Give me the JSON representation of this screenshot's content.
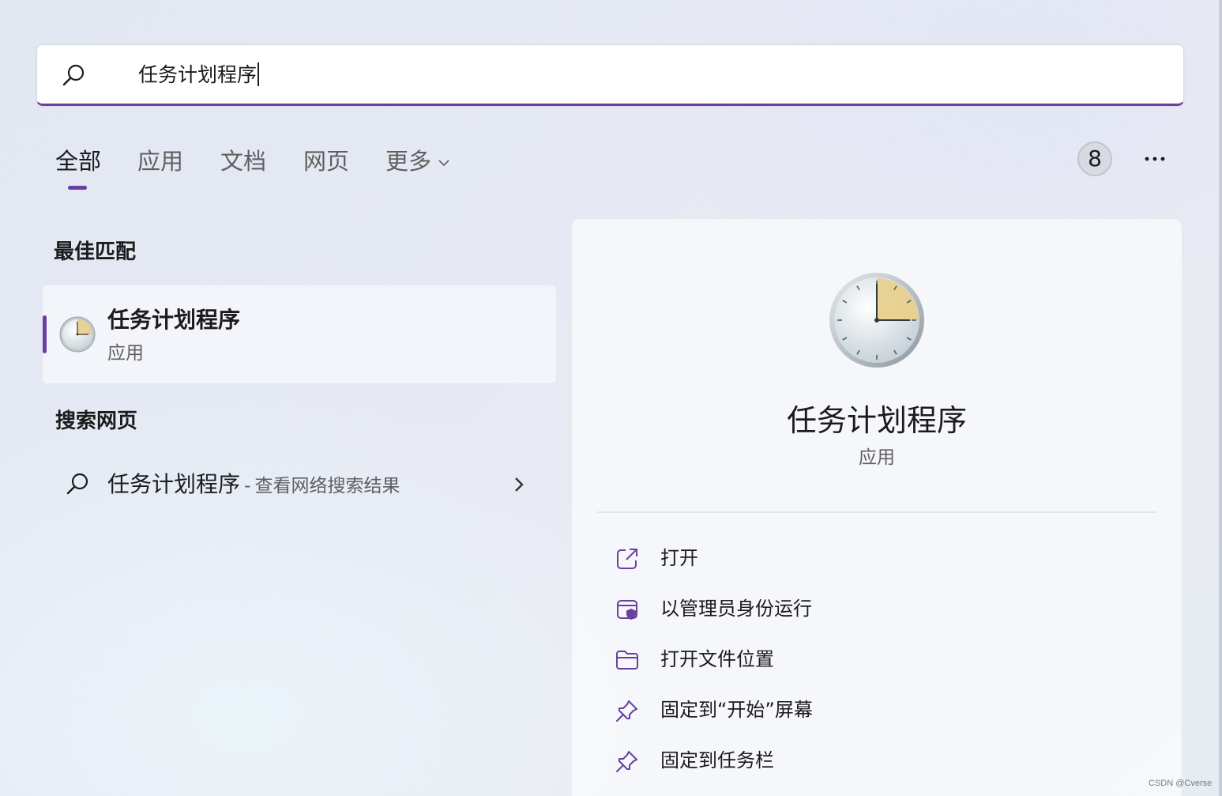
{
  "search": {
    "query": "任务计划程序",
    "icon": "search-icon"
  },
  "tabs": [
    {
      "label": "全部",
      "active": true
    },
    {
      "label": "应用",
      "active": false
    },
    {
      "label": "文档",
      "active": false
    },
    {
      "label": "网页",
      "active": false
    },
    {
      "label": "更多",
      "active": false
    }
  ],
  "result_count": "8",
  "colors": {
    "accent": "#6b3fa0",
    "icon_stroke": "#6b3fa0",
    "clock_face_highlight": "#e8cf8a"
  },
  "best_match": {
    "section_title": "最佳匹配",
    "name": "任务计划程序",
    "type": "应用",
    "icon": "task-scheduler-clock-icon"
  },
  "web_search": {
    "section_title": "搜索网页",
    "query": "任务计划程序",
    "separator": "-",
    "hint": "查看网络搜索结果"
  },
  "preview": {
    "title": "任务计划程序",
    "subtitle": "应用",
    "actions": [
      {
        "label": "打开",
        "icon": "open-external-icon"
      },
      {
        "label": "以管理员身份运行",
        "icon": "admin-shield-icon"
      },
      {
        "label": "打开文件位置",
        "icon": "folder-icon"
      },
      {
        "label": "固定到“开始”屏幕",
        "icon": "pin-icon"
      },
      {
        "label": "固定到任务栏",
        "icon": "pin-icon"
      }
    ]
  },
  "watermark": "CSDN @Cverse"
}
